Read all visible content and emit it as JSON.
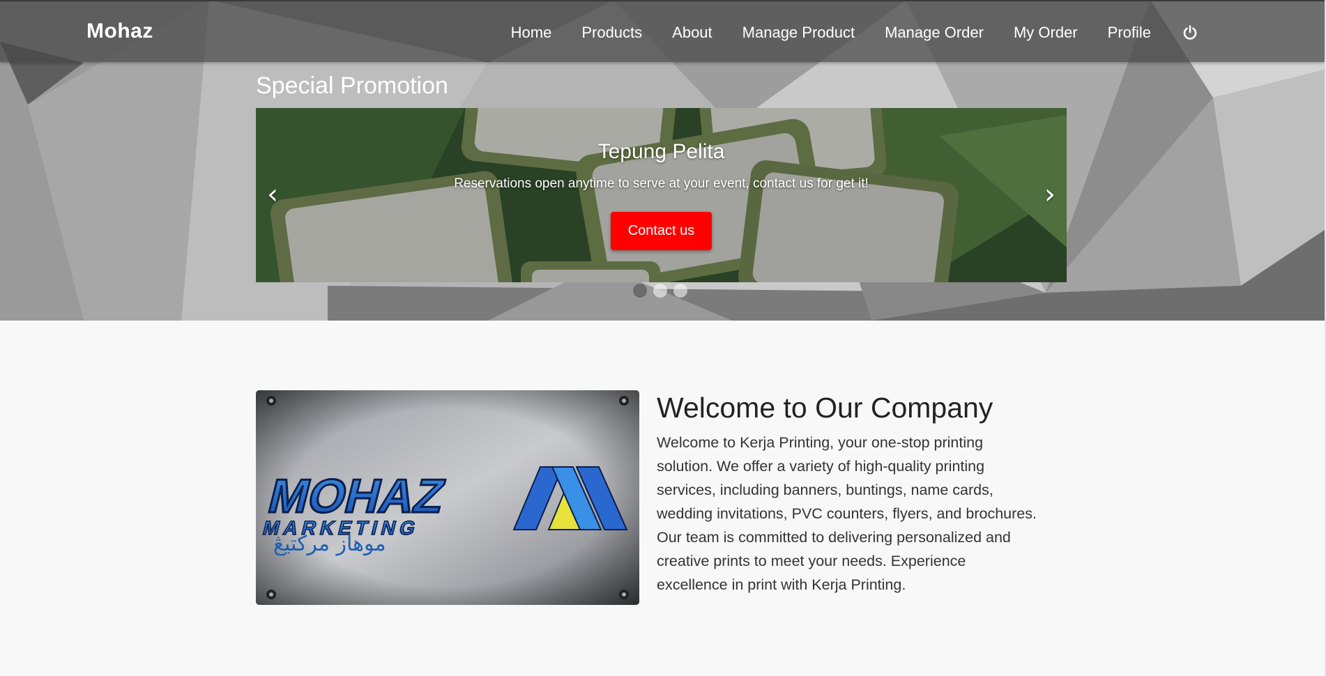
{
  "navbar": {
    "brand": "Mohaz",
    "links": [
      "Home",
      "Products",
      "About",
      "Manage Product",
      "Manage Order",
      "My Order",
      "Profile"
    ],
    "logout_icon": "power-icon"
  },
  "promo": {
    "heading": "Special Promotion",
    "slide": {
      "title": "Tepung Pelita",
      "description": "Reservations open anytime to serve at your event, contact us for get it!",
      "button": "Contact us"
    },
    "prev_glyph": "‹",
    "next_glyph": "›",
    "slide_count": 3,
    "active_slide": 1
  },
  "welcome": {
    "title": "Welcome to Our Company",
    "body": "Welcome to Kerja Printing, your one-stop printing solution. We offer a variety of high-quality printing services, including banners, buntings, name cards, wedding invitations, PVC counters, flyers, and brochures. Our team is committed to delivering personalized and creative prints to meet your needs. Experience excellence in print with Kerja Printing.",
    "logo": {
      "line1": "MOHAZ",
      "line2": "MARKETING",
      "arabic": "موهاز مركتيڠ"
    }
  },
  "colors": {
    "cta": "#ff0000",
    "navbar": "#464646",
    "page_bg": "#f8f8f8"
  }
}
